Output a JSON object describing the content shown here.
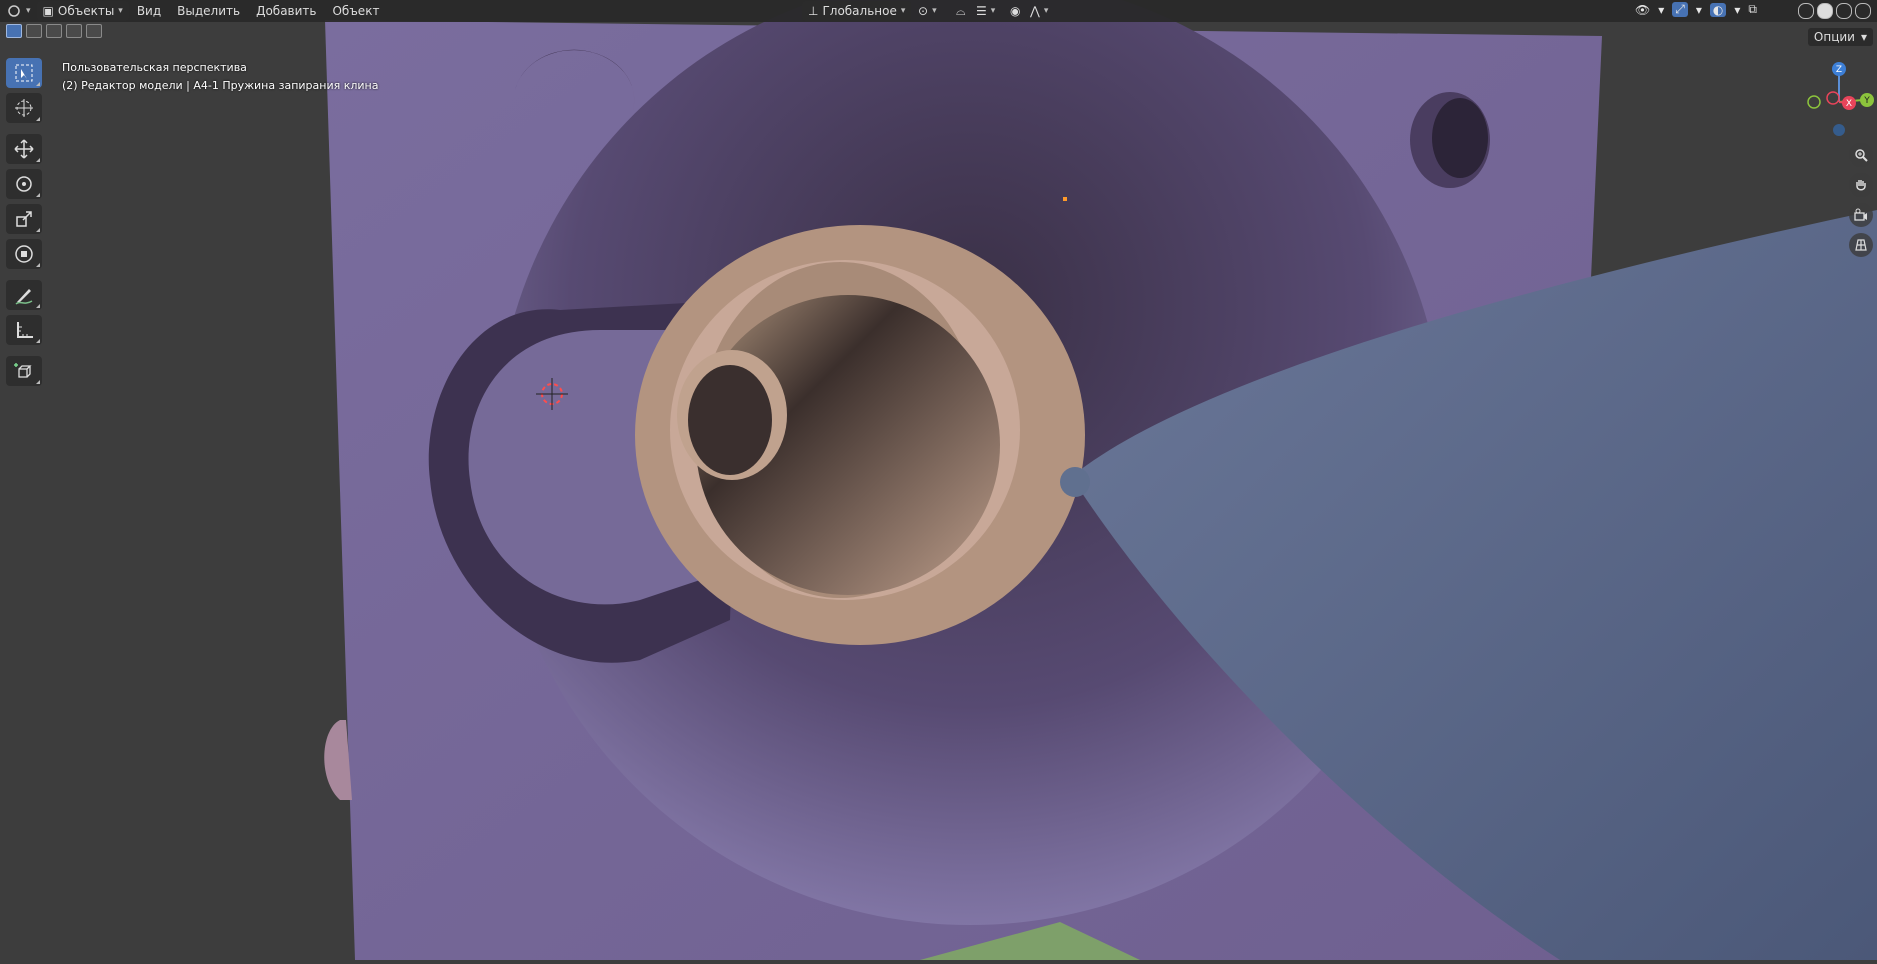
{
  "header": {
    "mode": "Объекты",
    "menus": [
      "Вид",
      "Выделить",
      "Добавить",
      "Объект"
    ],
    "transform_orientation": "Глобальное"
  },
  "viewport": {
    "view_name": "Пользовательская перспектива",
    "object_info": "(2) Редактор модели | A4-1 Пружина запирания клина",
    "options_label": "Опции"
  },
  "gizmo": {
    "z": "Z",
    "x": "X",
    "y": "Y"
  },
  "colors": {
    "plate": "#7a6a98",
    "bushing": "#b28d79",
    "cone": "#5d6a8a",
    "accent": "#4772b3"
  },
  "icons": [
    "select-box-icon",
    "cursor-icon",
    "move-icon",
    "rotate-icon",
    "scale-icon",
    "transform-icon",
    "annotate-icon",
    "measure-icon",
    "add-cube-icon",
    "zoom-icon",
    "hand-icon",
    "camera-icon",
    "grid-icon"
  ]
}
